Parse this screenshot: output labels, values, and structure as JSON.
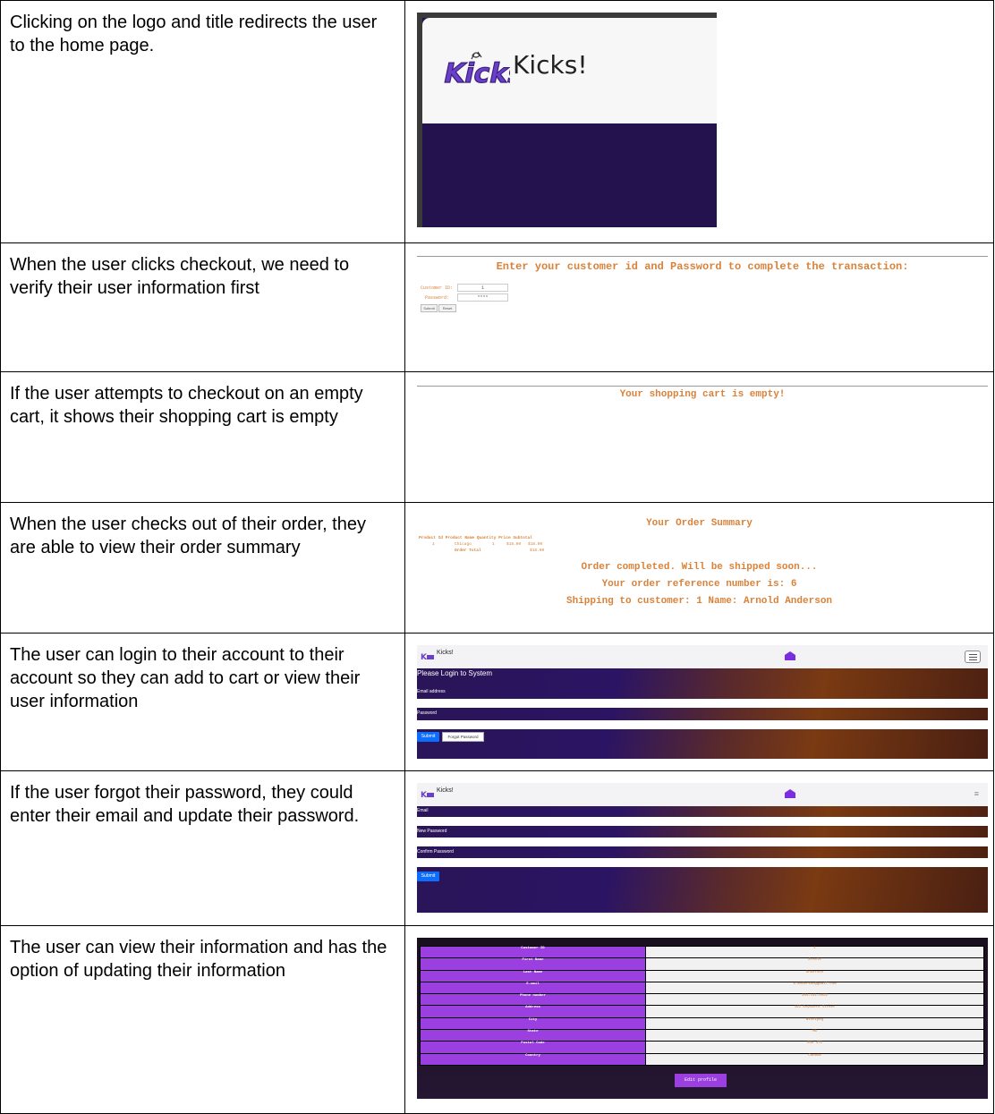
{
  "rows": [
    {
      "description": "Clicking on the logo and title redirects the user to the home page.",
      "screenshot": {
        "logo_text": "Kicks",
        "title": "Kicks!"
      }
    },
    {
      "description": "When the user clicks checkout, we need to verify their user information first",
      "screenshot": {
        "heading": "Enter your customer id and Password to complete the transaction:",
        "customer_id_label": "Customer ID:",
        "customer_id_value": "1",
        "password_label": "Password:",
        "password_value": "****",
        "submit_label": "Submit",
        "reset_label": "Reset"
      }
    },
    {
      "description": "If the user attempts to checkout on an empty cart, it shows their shopping cart is empty",
      "screenshot": {
        "message": "Your shopping cart is empty!"
      }
    },
    {
      "description": "When the user checks out of their order, they are able to view their order summary",
      "screenshot": {
        "title": "Your Order Summary",
        "table_headers": [
          "Product Id",
          "Product Name",
          "Quantity",
          "Price",
          "Subtotal"
        ],
        "table_row": [
          "1",
          "Chicago",
          "1",
          "$18.00",
          "$18.00"
        ],
        "order_total_label": "Order Total",
        "order_total_value": "$18.00",
        "completed": "Order completed. Will be shipped soon...",
        "reference": "Your order reference number is: 6",
        "shipping": "Shipping to customer: 1 Name: Arnold Anderson"
      }
    },
    {
      "description": "The user can login to their account to their account so they can add to cart or view their user information",
      "screenshot": {
        "brand": "Kicks!",
        "heading": "Please Login to System",
        "email_label": "Email address",
        "password_label": "Password",
        "submit_label": "Submit",
        "forgot_label": "Forgot Password"
      }
    },
    {
      "description": "If the user forgot their password, they could enter their email and update their password.",
      "screenshot": {
        "brand": "Kicks!",
        "email_label": "Email",
        "new_password_label": "New Password",
        "confirm_password_label": "Confirm Password",
        "submit_label": "Submit"
      }
    },
    {
      "description": "The user can view their information and has the option of updating their information",
      "screenshot": {
        "profile": [
          {
            "key": "Customer ID",
            "value": "1"
          },
          {
            "key": "First Name",
            "value": "Arnold"
          },
          {
            "key": "Last Name",
            "value": "Anderson"
          },
          {
            "key": "E-mail",
            "value": "a.anderson@gmail.com"
          },
          {
            "key": "Phone number",
            "value": "204-111-0022"
          },
          {
            "key": "Address",
            "value": "163 Anywhere Street"
          },
          {
            "key": "City",
            "value": "Winnipeg"
          },
          {
            "key": "State",
            "value": "MB"
          },
          {
            "key": "Postal Code",
            "value": "R3H 4T2"
          },
          {
            "key": "Country",
            "value": "Canada"
          }
        ],
        "edit_label": "Edit profile"
      }
    }
  ],
  "colors": {
    "accent_orange": "#d9823a",
    "accent_purple": "#9b3fe0",
    "navy": "#24124e",
    "bootstrap_blue": "#0d6efd"
  },
  "icons": [
    "kicks-logo-icon",
    "shoe-icon",
    "hamburger-menu-icon"
  ]
}
